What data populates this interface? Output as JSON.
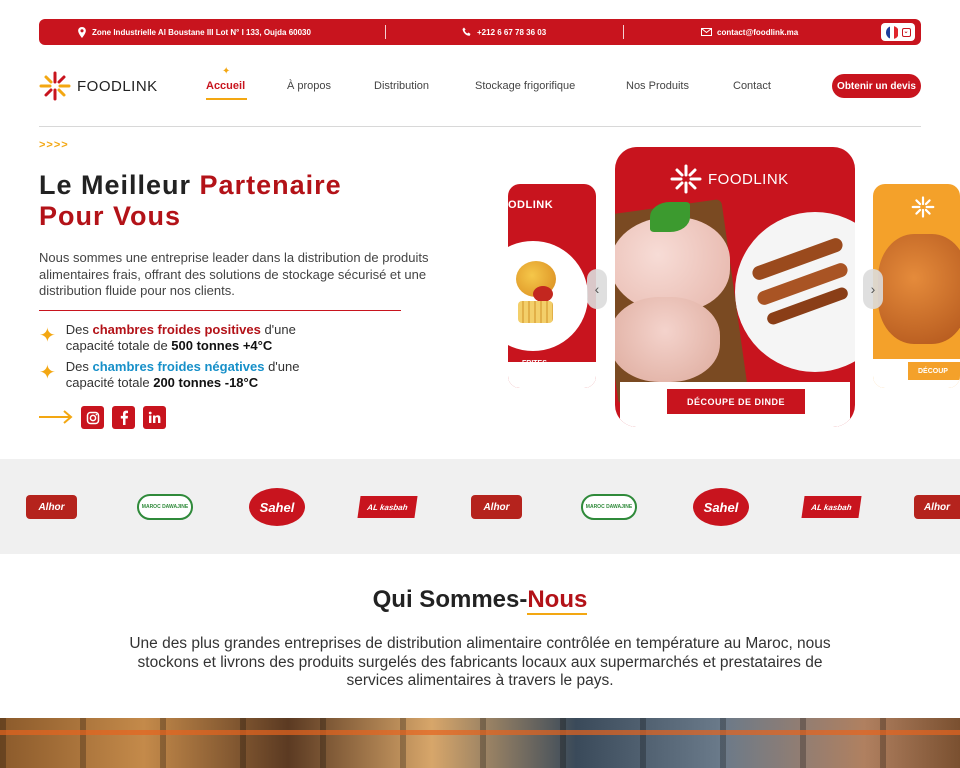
{
  "topbar": {
    "address": "Zone Industrielle Al Boustane III Lot N° I 133, Oujda 60030",
    "phone": "+212 6 67 78 36 03",
    "email": "contact@foodlink.ma"
  },
  "brand": {
    "logo_text": "FOODLINK"
  },
  "nav": {
    "items": [
      "Accueil",
      "À propos",
      "Distribution",
      "Stockage frigorifique",
      "Nos Produits",
      "Contact"
    ],
    "cta": "Obtenir un devis"
  },
  "hero": {
    "arrows": ">>>>",
    "title_plain": "Le Meilleur ",
    "title_red1": "Partenaire",
    "title_red2": "Pour Vous",
    "description": "Nous sommes une entreprise leader dans la distribution de produits alimentaires frais, offrant des solutions de stockage sécurisé et une distribution fluide pour nos clients.",
    "features": [
      {
        "pre": "Des ",
        "highlight": "chambres froides positives",
        "mid": " d'une capacité totale de ",
        "bold": "500 tonnes +4°C"
      },
      {
        "pre": "Des ",
        "highlight": "chambres froides négatives",
        "mid": " d'une capacité totale ",
        "bold": "200 tonnes -18°C"
      }
    ],
    "social": [
      "instagram",
      "facebook",
      "linkedin"
    ]
  },
  "slider": {
    "main_logo": "FOODLINK",
    "main_caption": "DÉCOUPE DE DINDE",
    "left_logo": "ODLINK",
    "left_caption": "FRITES",
    "left_caption2": "S 7/7",
    "right_caption": "DÉCOUP"
  },
  "brands": [
    "Alhor",
    "MAROC DAWAJINE",
    "Sahel",
    "AL kasbah",
    "Alhor",
    "MAROC DAWAJINE",
    "Sahel",
    "AL kasbah",
    "Alhor"
  ],
  "about": {
    "title_plain": "Qui Sommes-",
    "title_red": "Nous",
    "text": "Une des plus grandes entreprises de distribution alimentaire contrôlée en température au Maroc, nous stockons et livrons des produits surgelés des fabricants locaux aux supermarchés et prestataires de services alimentaires à travers le pays."
  },
  "colors": {
    "brand_red": "#c8141e",
    "accent_orange": "#f3a712",
    "accent_blue": "#1790c9"
  }
}
